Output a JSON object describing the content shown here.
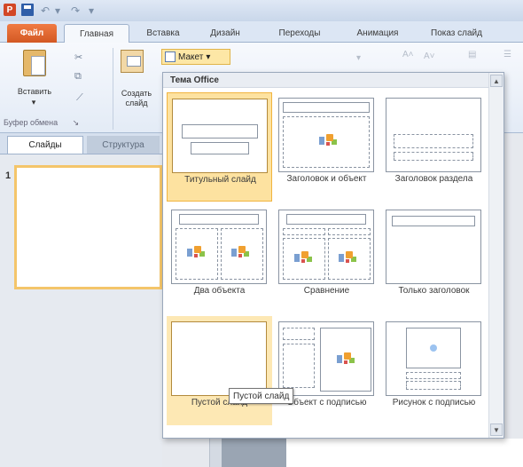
{
  "ribbon_tabs": {
    "file": "Файл",
    "home": "Главная",
    "insert": "Вставка",
    "design": "Дизайн",
    "transitions": "Переходы",
    "animations": "Анимация",
    "slideshow": "Показ слайд"
  },
  "ribbon": {
    "paste_label": "Вставить",
    "new_slide_label": "Создать\nслайд",
    "layout_button": "Макет",
    "clipboard_group": "Буфер обмена"
  },
  "left_panel": {
    "tab_slides": "Слайды",
    "tab_outline": "Структура",
    "slide_number": "1"
  },
  "gallery": {
    "header": "Тема Office",
    "layouts": [
      {
        "name": "Титульный слайд",
        "state": "selected",
        "thumb": "title"
      },
      {
        "name": "Заголовок и объект",
        "state": "normal",
        "thumb": "title-content"
      },
      {
        "name": "Заголовок раздела",
        "state": "normal",
        "thumb": "section"
      },
      {
        "name": "Два объекта",
        "state": "normal",
        "thumb": "two-content"
      },
      {
        "name": "Сравнение",
        "state": "normal",
        "thumb": "comparison"
      },
      {
        "name": "Только заголовок",
        "state": "normal",
        "thumb": "title-only"
      },
      {
        "name": "Пустой слайд",
        "state": "hover",
        "thumb": "blank"
      },
      {
        "name": "Объект с подписью",
        "state": "normal",
        "thumb": "content-caption"
      },
      {
        "name": "Рисунок с подписью",
        "state": "normal",
        "thumb": "picture-caption"
      }
    ]
  },
  "tooltip": "Пустой слайд",
  "colors": {
    "file_tab": "#d35823",
    "selection": "#fde2a0",
    "selection_border": "#f1b43f"
  }
}
